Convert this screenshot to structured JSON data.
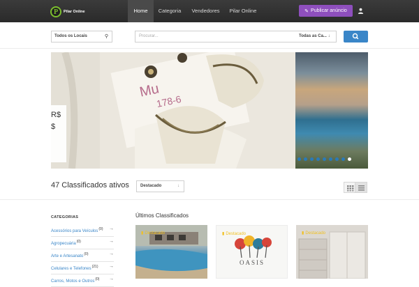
{
  "nav": {
    "brand": "Pilar Online",
    "items": [
      {
        "label": "Home"
      },
      {
        "label": "Categoria"
      },
      {
        "label": "Vendedores"
      },
      {
        "label": "Pilar Online"
      }
    ],
    "publish_label": "Publicar anúncio"
  },
  "search": {
    "location_label": "Todos os Locais",
    "placeholder": "Procurar...",
    "category_label": "Todas as Ca..."
  },
  "slider": {
    "price_lines": [
      "R$",
      "$"
    ],
    "dot_count": 9,
    "active_dot": 8
  },
  "results": {
    "count_text": "47 Classificados ativos",
    "sort_label": "Destacado"
  },
  "sidebar": {
    "heading": "CATEGORIAS",
    "categories": [
      {
        "label": "Acessórios para Veículos",
        "count": "(0)"
      },
      {
        "label": "Agropecuária",
        "count": "(0)"
      },
      {
        "label": "Arte e Artesanato",
        "count": "(0)"
      },
      {
        "label": "Celulares e Telefones",
        "count": "(21)"
      },
      {
        "label": "Carros, Motos e Outros",
        "count": "(0)"
      }
    ]
  },
  "listings": {
    "title": "Últimos Classificados",
    "items": [
      {
        "badge": "Destacado"
      },
      {
        "badge": "Destacado"
      },
      {
        "badge": "Destacado"
      }
    ],
    "logo_text": "OASIS"
  },
  "colors": {
    "navbar": "#2f2f2f",
    "accent_purple": "#8e4fbd",
    "accent_blue": "#3a86c8",
    "badge_yellow": "#f0c020"
  }
}
